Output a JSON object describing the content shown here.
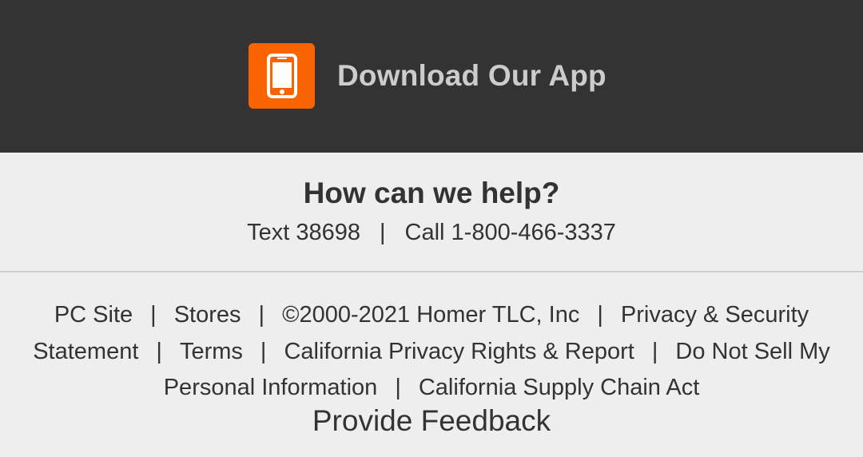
{
  "app_banner": {
    "title": "Download Our App",
    "icon": "smartphone-icon",
    "accent_color": "#f96302"
  },
  "help": {
    "title": "How can we help?",
    "text_label": "Text 38698",
    "separator": "|",
    "call_label": "Call 1-800-466-3337"
  },
  "footer": {
    "separator": "|",
    "links": {
      "pc_site": "PC Site",
      "stores": "Stores",
      "copyright": "©2000-2021 Homer TLC, Inc",
      "privacy": "Privacy & Security Statement",
      "terms": "Terms",
      "ca_privacy": "California Privacy Rights & Report",
      "do_not_sell": "Do Not Sell My Personal Information",
      "supply_chain": "California Supply Chain Act"
    },
    "feedback": "Provide Feedback"
  }
}
